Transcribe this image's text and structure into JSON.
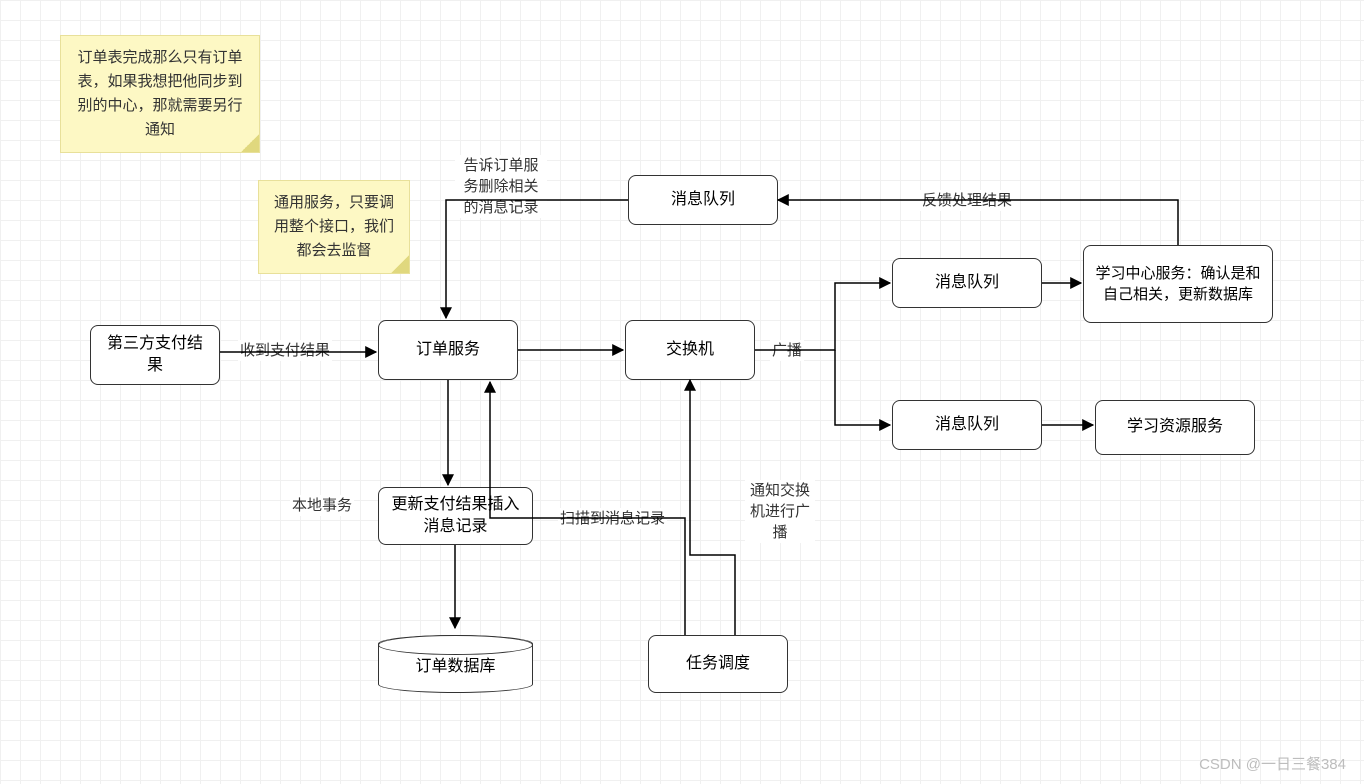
{
  "notes": {
    "n1": "订单表完成那么只有订单表，如果我想把他同步到别的中心，那就需要另行通知",
    "n2": "通用服务，只要调用整个接口，我们都会去监督"
  },
  "nodes": {
    "third_party": "第三方支付结果",
    "order_service": "订单服务",
    "exchange": "交换机",
    "mq_top": "消息队列",
    "mq_mid": "消息队列",
    "mq_bot": "消息队列",
    "learn_center": "学习中心服务：确认是和自己相关，更新数据库",
    "learn_resource": "学习资源服务",
    "update_pay": "更新支付结果插入消息记录",
    "order_db": "订单数据库",
    "task_sched": "任务调度"
  },
  "edges": {
    "recv_pay": "收到支付结果",
    "delete_msg": "告诉订单服务删除相关的消息记录",
    "local_tx": "本地事务",
    "scan_msg": "扫描到消息记录",
    "notify_bcast": "通知交换机进行广播",
    "broadcast": "广播",
    "feedback": "反馈处理结果"
  },
  "watermark": "CSDN @一日三餐384"
}
